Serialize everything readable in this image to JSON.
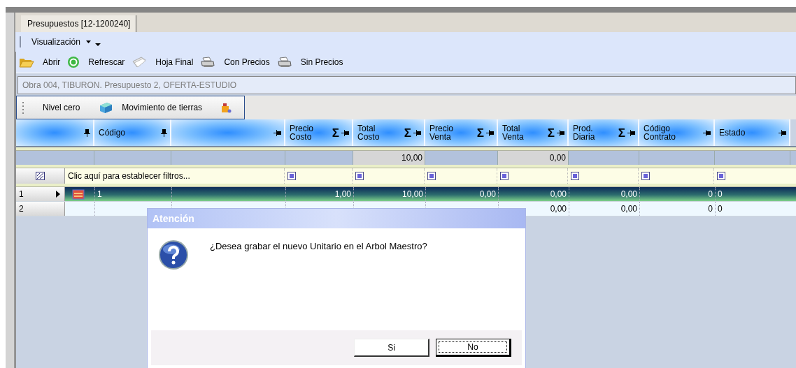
{
  "tab": {
    "label": "Presupuestos [12-1200240]"
  },
  "menu": [
    {
      "label": "Visualización"
    }
  ],
  "toolbar": [
    {
      "label": "Abrir",
      "kind": "folder"
    },
    {
      "label": "Refrescar",
      "kind": "refresh"
    },
    {
      "label": "Hoja Final",
      "kind": "sheet"
    },
    {
      "label": "Con Precios",
      "kind": "printer"
    },
    {
      "label": "Sin Precios",
      "kind": "printer"
    }
  ],
  "project_title": "Obra 004, TIBURON.  Presupuesto 2, OFERTA-ESTUDIO",
  "breadcrumb": [
    {
      "label": "Nivel cero",
      "kind": "text"
    },
    {
      "label": "Movimiento de tierras",
      "kind": "cube"
    },
    {
      "kind": "tool"
    }
  ],
  "grid": {
    "columns": [
      {
        "pinned": true
      },
      {
        "label": "Código",
        "pinned": true
      },
      {
        "pinned": false
      },
      {
        "label": "Precio\nCosto",
        "pinned": false,
        "sum_symbol": "Σ"
      },
      {
        "label": "Total\nCosto",
        "pinned": false,
        "sum_symbol": "Σ",
        "summary": "10,00"
      },
      {
        "label": "Precio\nVenta",
        "pinned": false,
        "sum_symbol": "Σ"
      },
      {
        "label": "Total\nVenta",
        "pinned": false,
        "sum_symbol": "Σ",
        "summary": "0,00"
      },
      {
        "label": "Prod.\nDiaria",
        "pinned": false,
        "sum_symbol": "Σ"
      },
      {
        "label": "Código\nContrato",
        "pinned": false
      },
      {
        "label": "Estado",
        "pinned": false
      }
    ],
    "filter_text": "Clic aquí para establecer filtros...",
    "rows": [
      {
        "number": "1",
        "selected": true,
        "has_icon": true,
        "code": "1",
        "values": [
          "1,00",
          "10,00",
          "0,00",
          "0,00",
          "0,00",
          "0",
          "0"
        ]
      },
      {
        "number": "2",
        "selected": false,
        "has_icon": false,
        "values": [
          "0,00",
          "0,00",
          "0",
          "0"
        ]
      }
    ]
  },
  "dialog": {
    "title": "Atención",
    "message": "¿Desea grabar el nuevo Unitario en el Arbol Maestro?",
    "buttons": [
      {
        "label": "Si",
        "focused": false
      },
      {
        "label": "No",
        "focused": true
      }
    ]
  }
}
